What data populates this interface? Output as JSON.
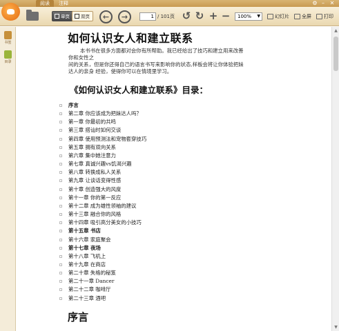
{
  "tabs": [
    "阅读",
    "注释"
  ],
  "toolbar": {
    "view_single": "单页",
    "view_double": "双页",
    "page_current": "1",
    "page_total": "/ 101页",
    "zoom_value": "100%",
    "slideshow": "幻灯片",
    "fullscreen": "全屏",
    "print": "打印"
  },
  "left_panel": {
    "bookmark": "书签",
    "toc": "目录"
  },
  "document": {
    "title": "如何认识女人和建立联系",
    "intro_lines": [
      "本书书在很多方面都对会你有所帮助。我已经给出了技巧和建立用来改善",
      "你和女性之",
      "间的关系，但是你还得自己的语言书写来影响你的状态,样板会将让你体验把妹",
      "达人的亲身 经验，使得你可以在情境里学习。"
    ],
    "toc_heading": "《如何认识女人和建立联系》目录：",
    "toc": [
      "序言",
      "第二章 你应该成为把妹达人吗？",
      "第一章 你最初的共鸣",
      "第三章 搭讪时如何交谈",
      "第四章 使用预测法和宠物套穿技巧",
      "第五章 拥有双向关系",
      "第六章 集中她注意力",
      "第七章 真诚兴趣vs饥渴兴趣",
      "第八章 转换成私人关系",
      "第九章 让谈话变得性感",
      "第十章 创造强大的风度",
      "第十一章 你的第一反应",
      "第十二章 成为雄性领袖的建议",
      "第十三章 融合你的风格",
      "第十四章 吸引高分美女的小技巧",
      "第十五章 书店",
      "第十六章 家庭聚会",
      "第十七章 夜场",
      "第十八章 飞机上",
      "第十九章 在商店",
      "第二十章 失格的秘笈",
      "第二十一章 Dancer",
      "第二十二章 咖啡厅",
      "第二十三章 酒吧"
    ],
    "section_heading": "序言"
  }
}
